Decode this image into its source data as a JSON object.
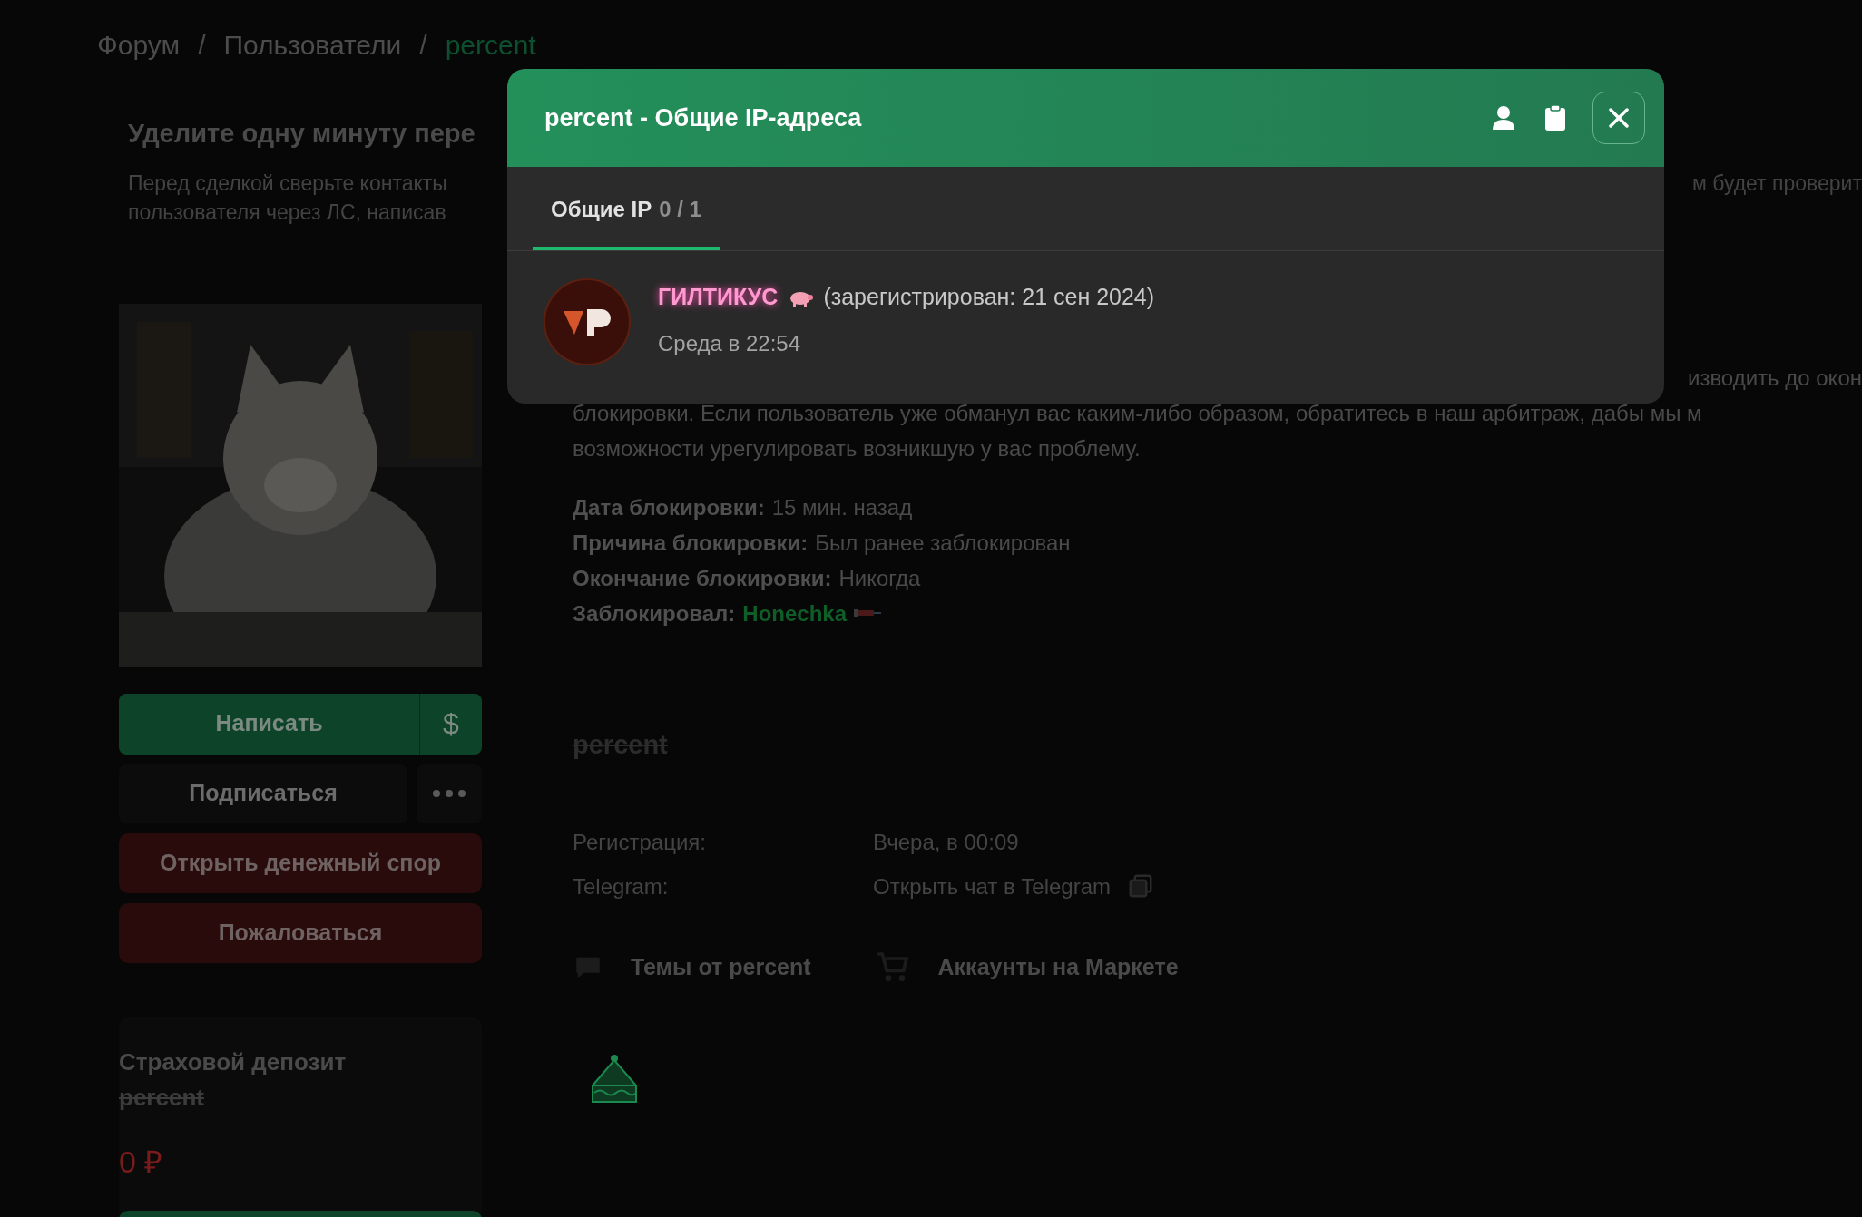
{
  "breadcrumb": [
    {
      "kind": "link",
      "label": "Форум"
    },
    {
      "kind": "separator",
      "label": "/"
    },
    {
      "kind": "link",
      "label": "Пользователи"
    },
    {
      "kind": "separator",
      "label": "/"
    },
    {
      "kind": "current",
      "label": "percent"
    }
  ],
  "notice": {
    "title": "Уделите одну минуту пере",
    "lines": [
      {
        "left": "Перед сделкой сверьте контакты",
        "right": "м будет проверит"
      },
      {
        "left": "пользователя через ЛС, написав"
      }
    ]
  },
  "actions": [
    {
      "kind": "primary",
      "label": "Написать",
      "side_label": "$"
    },
    {
      "kind": "secondary",
      "label": "Подписаться"
    },
    {
      "kind": "danger",
      "label": "Открыть денежный спор"
    },
    {
      "kind": "danger",
      "label": "Пожаловаться"
    }
  ],
  "deposit": {
    "title": "Страховой депозит",
    "username": "percent",
    "amount": "0 ₽"
  },
  "ban_notice": {
    "fragment": "изводить до окон",
    "lines": [
      "блокировки. Если пользователь уже обманул вас каким-либо образом, обратитесь в наш арбитраж, дабы мы м",
      "возможности урегулировать возникшую у вас проблему."
    ]
  },
  "ban_details": [
    {
      "kind": "text",
      "label": "Дата блокировки:",
      "value": "15 мин. назад"
    },
    {
      "kind": "text",
      "label": "Причина блокировки:",
      "value": "Был ранее заблокирован"
    },
    {
      "kind": "text",
      "label": "Окончание блокировки:",
      "value": "Никогда"
    },
    {
      "kind": "user",
      "label": "Заблокировал:",
      "value": "Honechka"
    }
  ],
  "profile": {
    "username": "percent",
    "banned": true
  },
  "info": [
    {
      "kind": "text",
      "label": "Регистрация:",
      "value": "Вчера, в 00:09"
    },
    {
      "kind": "link",
      "label": "Telegram:",
      "value": "Открыть чат в Telegram"
    }
  ],
  "links": [
    {
      "kind": "chat",
      "label": "Темы от percent"
    },
    {
      "kind": "cart",
      "label": "Аккаунты на Маркете"
    }
  ],
  "modal": {
    "title": "percent - Общие IP-адреса",
    "tabs": [
      {
        "label": "Общие IP",
        "count": "0 / 1",
        "selected": true
      }
    ],
    "users": [
      {
        "name": "ГИЛТИКУС",
        "registered": "(зарегистрирован: 21 сен 2024)",
        "last_seen": "Среда в 22:54"
      }
    ]
  }
}
